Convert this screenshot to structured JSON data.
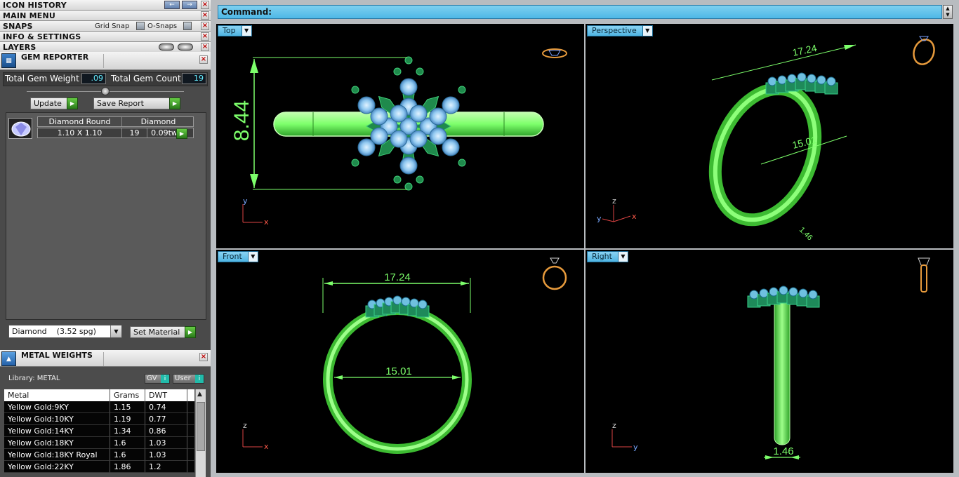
{
  "left_panel": {
    "icon_history": "ICON HISTORY",
    "main_menu": "MAIN MENU",
    "snaps": "SNAPS",
    "grid_snap": "Grid Snap",
    "o_snaps": "O-Snaps",
    "info_settings": "INFO & SETTINGS",
    "layers": "LAYERS"
  },
  "gem_reporter": {
    "title": "GEM REPORTER",
    "total_weight_label": "Total Gem Weight",
    "total_weight_value": ".09",
    "total_count_label": "Total Gem Count",
    "total_count_value": "19",
    "update_label": "Update",
    "save_report_label": "Save Report",
    "table": {
      "header": [
        "Diamond Round",
        "Diamond"
      ],
      "row": {
        "size": "1.10 X 1.10",
        "count": "19",
        "weight": "0.09tw"
      }
    },
    "material_select": "Diamond    (3.52 spg)",
    "set_material_label": "Set Material"
  },
  "metal_weights": {
    "title": "METAL WEIGHTS",
    "library": "Library: METAL",
    "gv_label": "GV",
    "user_label": "User",
    "columns": [
      "Metal",
      "Grams",
      "DWT"
    ],
    "rows": [
      [
        "Yellow Gold:9KY",
        "1.15",
        "0.74"
      ],
      [
        "Yellow Gold:10KY",
        "1.19",
        "0.77"
      ],
      [
        "Yellow Gold:14KY",
        "1.34",
        "0.86"
      ],
      [
        "Yellow Gold:18KY",
        "1.6",
        "1.03"
      ],
      [
        "Yellow Gold:18KY Royal",
        "1.6",
        "1.03"
      ],
      [
        "Yellow Gold:22KY",
        "1.86",
        "1.2"
      ]
    ]
  },
  "command": {
    "label": "Command:"
  },
  "viewports": {
    "top": {
      "label": "Top",
      "dim": "8.44"
    },
    "perspective": {
      "label": "Perspective",
      "dim_a": "17.24",
      "dim_b": "15.01",
      "dim_c": "1.46"
    },
    "front": {
      "label": "Front",
      "dim_a": "17.24",
      "dim_b": "15.01"
    },
    "right": {
      "label": "Right",
      "dim": "1.46"
    }
  },
  "axis": {
    "x": "x",
    "y": "y",
    "z": "z"
  },
  "colors": {
    "ring_green": "#7dff6b",
    "gem_blue": "#8fc8f0",
    "viewport_tab": "#4fb4e2",
    "command_bar": "#56bde8"
  }
}
